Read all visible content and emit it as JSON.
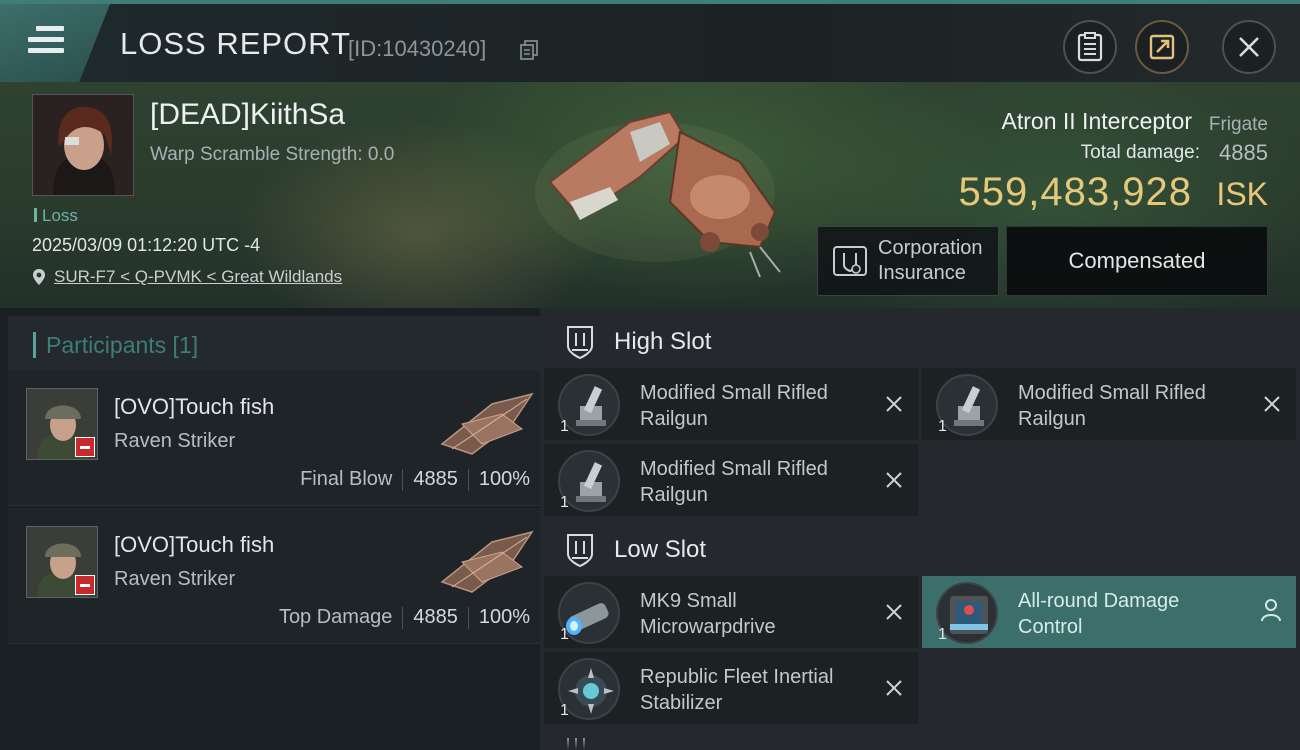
{
  "header": {
    "title": "LOSS REPORT",
    "report_id": "[ID:10430240]",
    "menu_icon": "hamburger-menu-icon",
    "buttons": [
      "notes-icon",
      "share-icon",
      "close-icon"
    ]
  },
  "victim": {
    "pilot_name": "[DEAD]KiithSa",
    "warp_scramble": "Warp Scramble Strength: 0.0",
    "report_type": "Loss",
    "timestamp": "2025/03/09 01:12:20 UTC -4",
    "location": "SUR-F7 < Q-PVMK < Great Wildlands",
    "ship_name": "Atron II Interceptor",
    "ship_class": "Frigate",
    "total_damage_label": "Total damage:",
    "total_damage": "4885",
    "isk_value": "559,483,928",
    "isk_unit": "ISK",
    "insurance_label_1": "Corporation",
    "insurance_label_2": "Insurance",
    "compensation_status": "Compensated"
  },
  "participants": {
    "header": "Participants [1]",
    "items": [
      {
        "name": "[OVO]Touch fish",
        "ship": "Raven Striker",
        "label": "Final Blow",
        "damage": "4885",
        "percent": "100%"
      },
      {
        "name": "[OVO]Touch fish",
        "ship": "Raven Striker",
        "label": "Top Damage",
        "damage": "4885",
        "percent": "100%"
      }
    ]
  },
  "fitting": {
    "high_slot_label": "High Slot",
    "low_slot_label": "Low Slot",
    "high": [
      {
        "qty": "1",
        "name_1": "Modified Small Rifled",
        "name_2": "Railgun",
        "icon": "railgun-icon"
      },
      {
        "qty": "1",
        "name_1": "Modified Small Rifled",
        "name_2": "Railgun",
        "icon": "railgun-icon"
      },
      {
        "qty": "1",
        "name_1": "Modified Small Rifled",
        "name_2": "Railgun",
        "icon": "railgun-icon"
      }
    ],
    "low": [
      {
        "qty": "1",
        "name_1": "MK9 Small",
        "name_2": "Microwarpdrive",
        "icon": "microwarpdrive-icon"
      },
      {
        "qty": "1",
        "name_1": "All-round Damage",
        "name_2": "Control",
        "icon": "damage-control-icon",
        "selected": true
      },
      {
        "qty": "1",
        "name_1": "Republic Fleet Inertial",
        "name_2": "Stabilizer",
        "icon": "inertial-stabilizer-icon"
      }
    ]
  },
  "colors": {
    "accent": "#3f7d78",
    "isk_gold": "#e7c878",
    "selected_row": "#3c6f6b"
  }
}
